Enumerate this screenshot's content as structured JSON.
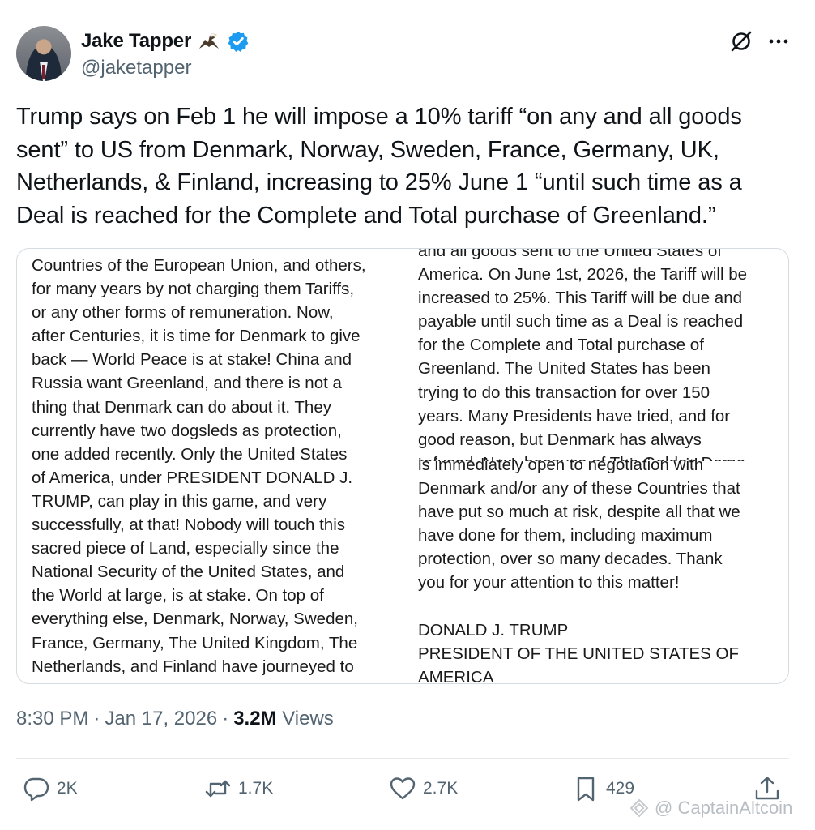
{
  "author": {
    "name": "Jake Tapper",
    "handle": "@jaketapper",
    "name_emoji_icon": "eagle-icon",
    "verified_icon": "verified-badge-icon"
  },
  "tweet_text_lines": [
    "Trump says on Feb 1 he will impose a  10% tariff “on any and all goods",
    "sent” to US from Denmark, Norway, Sweden, France, Germany, UK,",
    "Netherlands, & Finland, increasing to 25% June 1 “until such time as a",
    "Deal is reached for the Complete and Total purchase of Greenland.”"
  ],
  "media": {
    "left_image_text": "Countries of the European Union, and others,\nfor many years by not charging them Tariffs,\nor any other forms of remuneration. Now,\nafter Centuries, it is time for Denmark to give\nback — World Peace is at stake! China and\nRussia want Greenland, and there is not a\nthing that Denmark can do about it. They\ncurrently have two dogsleds as protection,\none added recently. Only the United States\nof America, under PRESIDENT DONALD J.\nTRUMP, can play in this game, and very\nsuccessfully, at that! Nobody will touch this\nsacred piece of Land, especially since the\nNational Security of the United States, and\nthe World at large, is at stake. On top of\neverything else, Denmark, Norway, Sweden,\nFrance, Germany, The United Kingdom, The\nNetherlands, and Finland have journeyed to\nGreenland, for purposes unknown. This is",
    "right_image_text_top": "and all goods sent to the United States of\nAmerica. On June 1st, 2026, the Tariff will be\nincreased to 25%. This Tariff will be due and\npayable until such time as a Deal is reached\nfor the Complete and Total purchase of\nGreenland. The United States has been\ntrying to do this transaction for over 150\nyears. Many Presidents have tried, and for\ngood reason, but Denmark has always\nrefused. Now, because of The Golden Dome",
    "right_image_text_bottom": "is immediately open to negotiation with\nDenmark and/or any of these Countries that\nhave put so much at risk, despite all that we\nhave done for them, including maximum\nprotection, over so many decades. Thank\nyou for your attention to this matter!\n\nDONALD J. TRUMP\nPRESIDENT OF THE UNITED STATES OF\nAMERICA"
  },
  "meta": {
    "time": "8:30 PM",
    "separator1": "·",
    "date": "Jan 17, 2026",
    "separator2": "·",
    "views_count": "3.2M",
    "views_label": "Views"
  },
  "actions": {
    "reply": {
      "icon": "reply-icon",
      "count": "2K"
    },
    "repost": {
      "icon": "repost-icon",
      "count": "1.7K"
    },
    "like": {
      "icon": "heart-icon",
      "count": "2.7K"
    },
    "bookmark": {
      "icon": "bookmark-icon",
      "count": "429"
    },
    "share": {
      "icon": "share-icon"
    }
  },
  "watermark": "@ CaptainAltcoin",
  "colors": {
    "text_primary": "#0f1419",
    "text_secondary": "#536471",
    "verified_blue": "#1d9bf0",
    "border": "#d6dbe0"
  }
}
